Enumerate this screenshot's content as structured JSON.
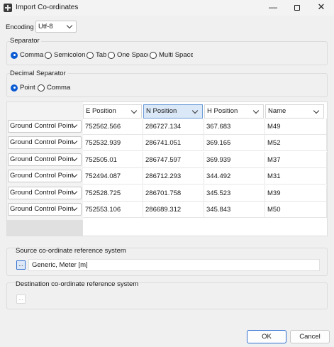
{
  "window": {
    "title": "Import Co-ordinates",
    "minimize": "—",
    "close": "✕"
  },
  "encoding": {
    "label": "Encoding",
    "value": "Utf-8"
  },
  "separator": {
    "label": "Separator",
    "options": [
      {
        "label": "Comma",
        "checked": true
      },
      {
        "label": "Semicolon",
        "checked": false
      },
      {
        "label": "Tab",
        "checked": false
      },
      {
        "label": "One Space",
        "checked": false
      },
      {
        "label": "Multi Space",
        "checked": false
      }
    ]
  },
  "decimal_separator": {
    "label": "Decimal Separator",
    "options": [
      {
        "label": "Point",
        "checked": true
      },
      {
        "label": "Comma",
        "checked": false
      }
    ]
  },
  "table": {
    "headers": [
      "E Position",
      "N Position",
      "H Position",
      "Name"
    ],
    "row_type": "Ground Control Point",
    "rows": [
      [
        "752562.566",
        "286727.134",
        "367.683",
        "M49"
      ],
      [
        "752532.939",
        "286741.051",
        "369.165",
        "M52"
      ],
      [
        "752505.01",
        "286747.597",
        "369.939",
        "M37"
      ],
      [
        "752494.087",
        "286712.293",
        "344.492",
        "M31"
      ],
      [
        "752528.725",
        "286701.758",
        "345.523",
        "M39"
      ],
      [
        "752553.106",
        "286689.312",
        "345.843",
        "M50"
      ]
    ]
  },
  "source_crs": {
    "label": "Source co-ordinate reference system",
    "button": "...",
    "value": "Generic, Meter [m]"
  },
  "destination_crs": {
    "label": "Destination co-ordinate reference system",
    "button": "..."
  },
  "buttons": {
    "ok": "OK",
    "cancel": "Cancel"
  }
}
